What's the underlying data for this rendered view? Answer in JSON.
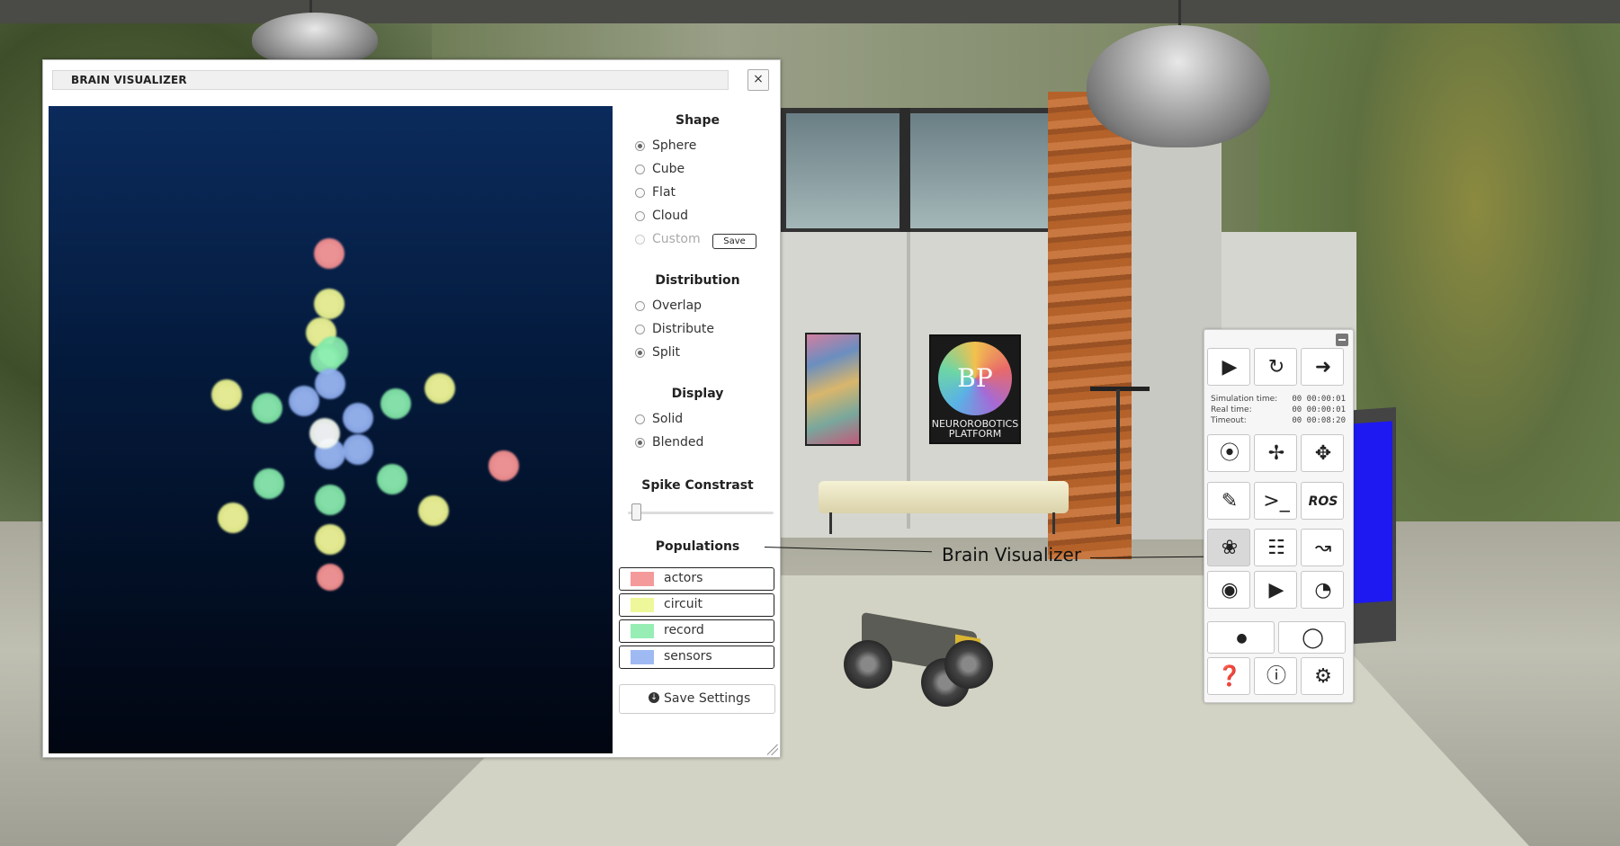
{
  "window": {
    "title": "BRAIN VISUALIZER",
    "close_label": "×"
  },
  "shape": {
    "title": "Shape",
    "options": [
      "Sphere",
      "Cube",
      "Flat",
      "Cloud",
      "Custom"
    ],
    "selected": "Sphere",
    "save_label": "Save"
  },
  "distribution": {
    "title": "Distribution",
    "options": [
      "Overlap",
      "Distribute",
      "Split"
    ],
    "selected": "Split"
  },
  "display": {
    "title": "Display",
    "options": [
      "Solid",
      "Blended"
    ],
    "selected": "Blended"
  },
  "spike_contrast": {
    "title": "Spike Constrast",
    "value": 0.05
  },
  "populations": {
    "title": "Populations",
    "items": [
      {
        "label": "actors",
        "color": "#f49a9a"
      },
      {
        "label": "circuit",
        "color": "#eef79a"
      },
      {
        "label": "record",
        "color": "#96eeb5"
      },
      {
        "label": "sensors",
        "color": "#9fbaf3"
      }
    ]
  },
  "save_settings_label": "Save Settings",
  "callout": "Brain Visualizer",
  "toolbar": {
    "clock": {
      "simulation_label": "Simulation time:",
      "simulation_value": "00 00:00:01",
      "real_label": "Real time:",
      "real_value": "00 00:00:01",
      "timeout_label": "Timeout:",
      "timeout_value": "00 00:08:20"
    },
    "ros_label": "ROS",
    "icons": [
      "play-icon",
      "reset-icon",
      "exit-icon",
      "compass-icon",
      "move-icon",
      "orbit-icon",
      "edit-icon",
      "terminal-icon",
      "ros-icon",
      "brain-icon",
      "spike-train-icon",
      "plot-icon",
      "eye-icon",
      "video-icon",
      "timer-icon",
      "light-low-icon",
      "light-high-icon",
      "help-icon",
      "info-icon",
      "settings-icon"
    ]
  },
  "poster": {
    "logo": "BP",
    "text": "NEUROROBOTICS PLATFORM"
  }
}
